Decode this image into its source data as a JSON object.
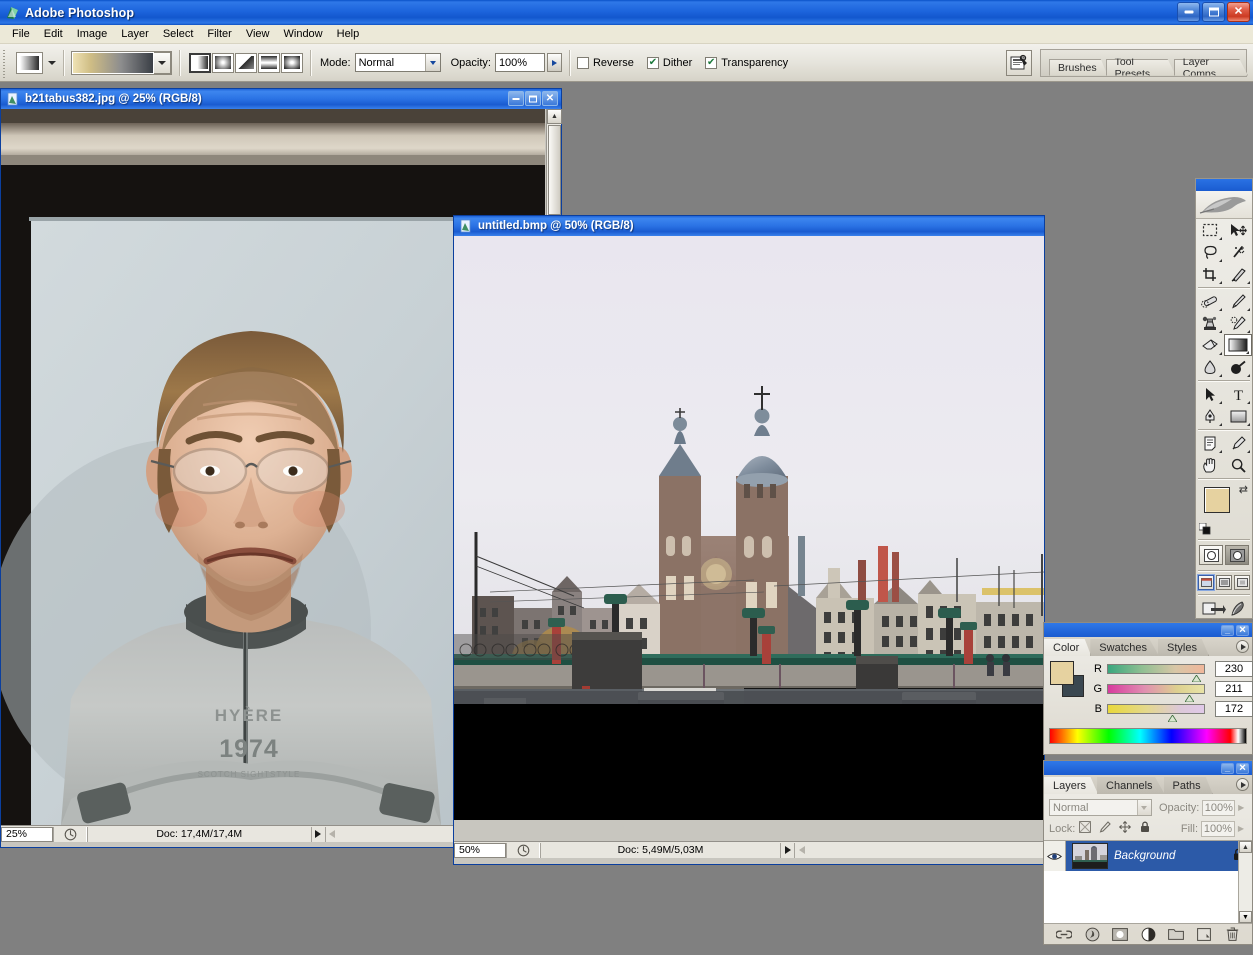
{
  "app": {
    "title": "Adobe Photoshop",
    "icon": "photoshop-icon",
    "window_buttons": {
      "minimize": "_",
      "maximize": "□",
      "close": "✕"
    }
  },
  "menubar": {
    "items": [
      "File",
      "Edit",
      "Image",
      "Layer",
      "Select",
      "Filter",
      "View",
      "Window",
      "Help"
    ]
  },
  "options_bar": {
    "tool": "gradient-tool",
    "gradient_picker_label": "gradient-preset",
    "gradient_types": [
      "linear-gradient",
      "radial-gradient",
      "angle-gradient",
      "reflected-gradient",
      "diamond-gradient"
    ],
    "gradient_type_active": 0,
    "mode_label": "Mode:",
    "mode_value": "Normal",
    "opacity_label": "Opacity:",
    "opacity_value": "100%",
    "reverse_label": "Reverse",
    "reverse_checked": false,
    "dither_label": "Dither",
    "dither_checked": true,
    "transparency_label": "Transparency",
    "transparency_checked": true,
    "palette_well_tabs": [
      "Brushes",
      "Tool Presets",
      "Layer Comps"
    ]
  },
  "documents": [
    {
      "id": "doc-1",
      "title": "b21tabus382.jpg @ 25% (RGB/8)",
      "zoom": "25%",
      "doc_size": "Doc: 17,4M/17,4M",
      "active": false
    },
    {
      "id": "doc-2",
      "title": "untitled.bmp @ 50% (RGB/8)",
      "zoom": "50%",
      "doc_size": "Doc: 5,49M/5,03M",
      "active": true
    }
  ],
  "toolbox": {
    "tools": [
      "marquee-tool",
      "move-tool",
      "lasso-tool",
      "magic-wand-tool",
      "crop-tool",
      "slice-tool",
      "healing-brush-tool",
      "brush-tool",
      "clone-stamp-tool",
      "history-brush-tool",
      "eraser-tool",
      "gradient-tool",
      "blur-tool",
      "dodge-tool",
      "path-selection-tool",
      "type-tool",
      "pen-tool",
      "shape-tool",
      "notes-tool",
      "eyedropper-tool",
      "hand-tool",
      "zoom-tool"
    ],
    "selected_tool": "gradient-tool",
    "foreground_color": "#e6d2a0",
    "background_color": "#3a4750",
    "swap-colors-icon": "swap-colors-icon",
    "default-colors-icon": "default-colors-icon",
    "mask_modes": [
      "standard-mask-mode",
      "quick-mask-mode"
    ],
    "screen_modes": [
      "standard-screen-mode",
      "full-screen-with-menubar",
      "full-screen-mode"
    ],
    "jump_to": [
      "jump-to-imageready-icon"
    ]
  },
  "color_palette": {
    "tabs": [
      "Color",
      "Swatches",
      "Styles"
    ],
    "active_tab": "Color",
    "foreground_color": "#e6d2a0",
    "background_color": "#3a4750",
    "channels": [
      {
        "label": "R",
        "value": "230",
        "pos": 90
      },
      {
        "label": "G",
        "value": "211",
        "pos": 83
      },
      {
        "label": "B",
        "value": "172",
        "pos": 67
      }
    ]
  },
  "layers_palette": {
    "tabs": [
      "Layers",
      "Channels",
      "Paths"
    ],
    "active_tab": "Layers",
    "blend_mode": "Normal",
    "opacity_label": "Opacity:",
    "opacity_value": "100%",
    "lock_label": "Lock:",
    "lock_icons": [
      "lock-transparency-icon",
      "lock-image-icon",
      "lock-position-icon",
      "lock-all-icon"
    ],
    "fill_label": "Fill:",
    "fill_value": "100%",
    "layers": [
      {
        "name": "Background",
        "visible": true,
        "locked": true,
        "selected": true
      }
    ],
    "bottom_buttons": [
      "link-layers-icon",
      "layer-style-icon",
      "layer-mask-icon",
      "adjustment-layer-icon",
      "new-group-icon",
      "new-layer-icon",
      "delete-layer-icon"
    ]
  },
  "colors": {
    "titlebar_blue": "#1d64dc",
    "desktop_gray": "#808080",
    "panel_gray": "#ece9d8",
    "accent_selected": "#2c5aa8"
  }
}
